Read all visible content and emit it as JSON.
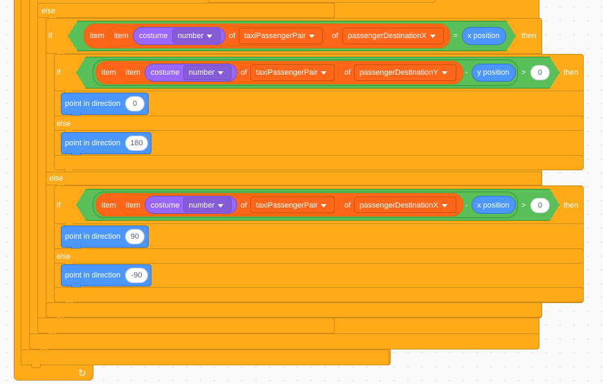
{
  "keywords": {
    "else": "else",
    "if": "if",
    "then": "then",
    "of": "of",
    "item": "item",
    "costume": "costume",
    "point_in_direction": "point in direction"
  },
  "condition1": {
    "dropdown_number": "number",
    "list": "taxiPassengerPair",
    "variable": "passengerDestinationX",
    "operator": "=",
    "reporter": "x position"
  },
  "condition2": {
    "dropdown_number": "number",
    "list": "taxiPassengerPair",
    "variable": "passengerDestinationY",
    "minus": "-",
    "reporter": "y position",
    "gt": ">",
    "value": "0"
  },
  "condition3": {
    "dropdown_number": "number",
    "list": "taxiPassengerPair",
    "variable": "passengerDestinationX",
    "minus": "-",
    "reporter": "x position",
    "gt": ">",
    "value": "0"
  },
  "directions": {
    "d1": "0",
    "d2": "180",
    "d3": "90",
    "d4": "-90"
  },
  "loop_arrow": "↻"
}
